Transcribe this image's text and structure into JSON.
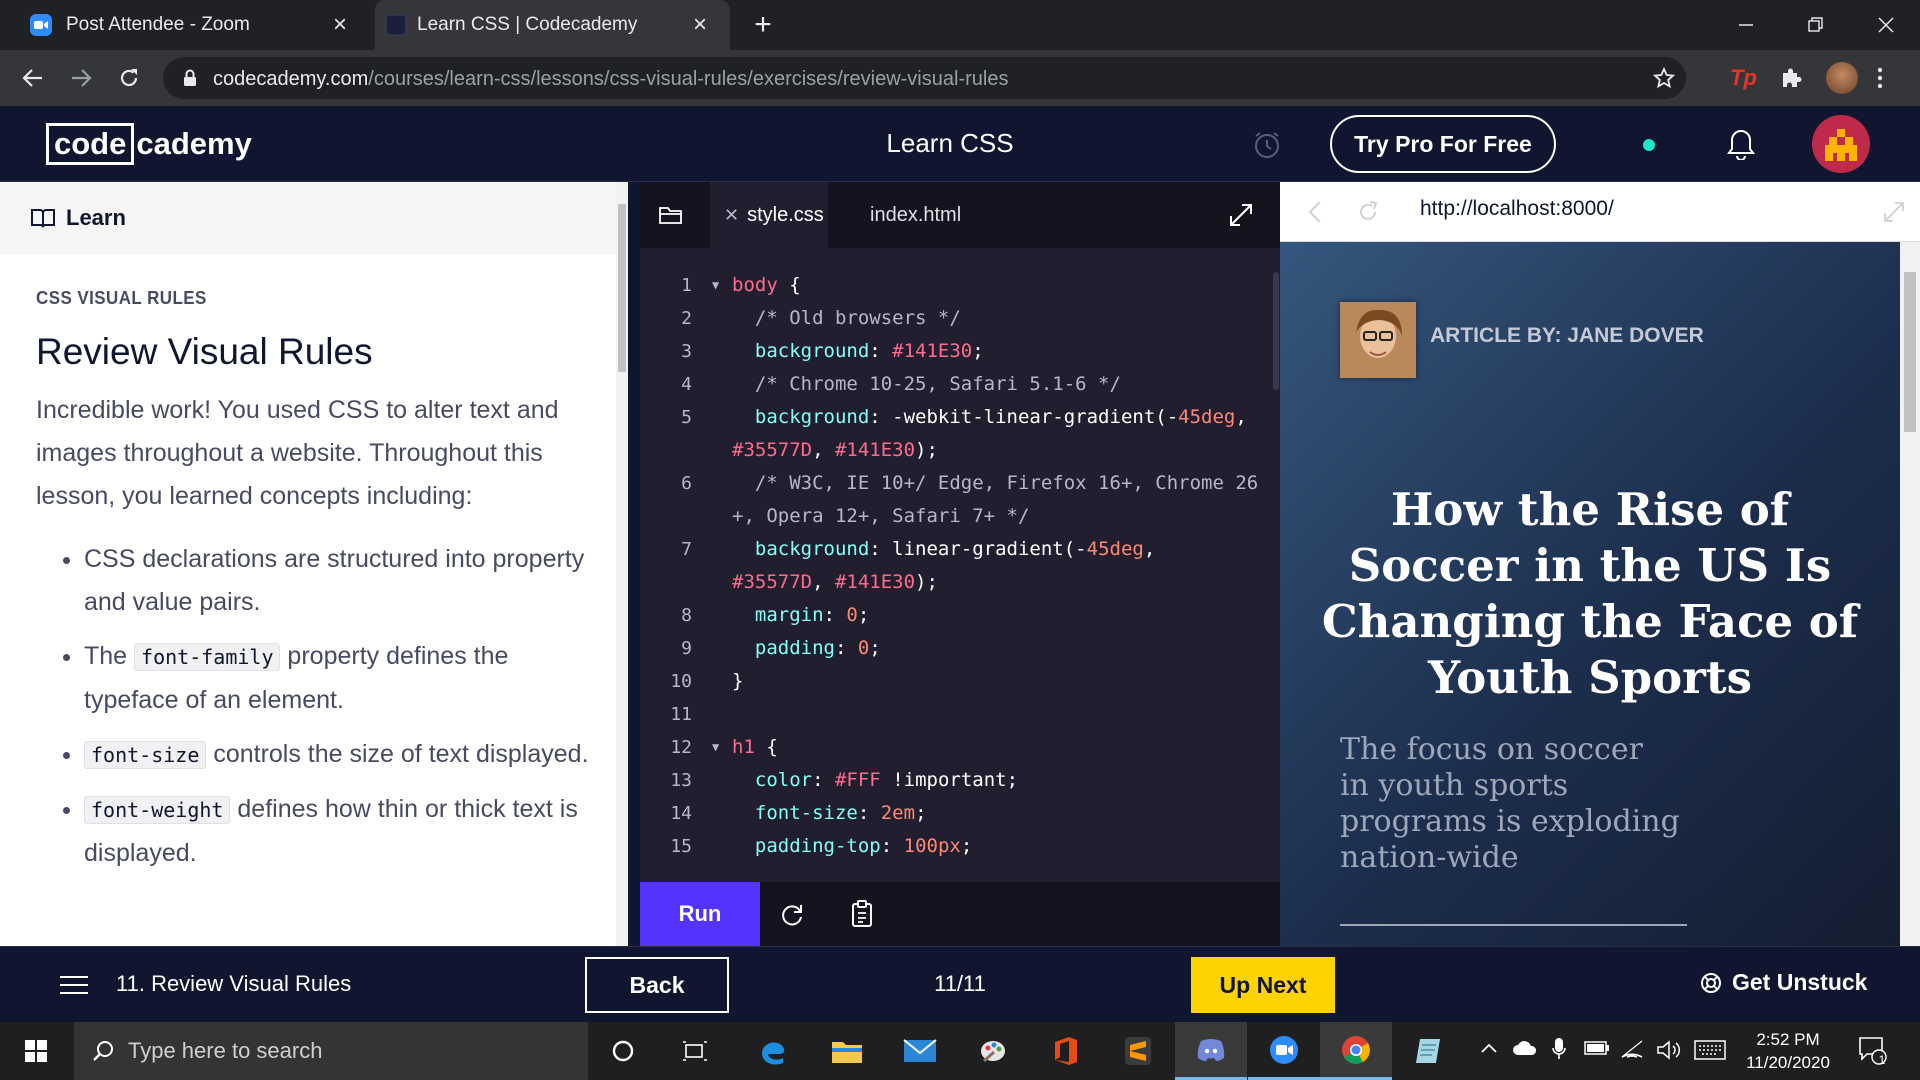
{
  "browser": {
    "tabs": [
      {
        "title": "Post Attendee - Zoom",
        "icon": "zoom-favicon"
      },
      {
        "title": "Learn CSS | Codecademy",
        "icon": "codecademy-favicon"
      }
    ],
    "url_host": "codecademy.com",
    "url_path": "/courses/learn-css/lessons/css-visual-rules/exercises/review-visual-rules",
    "extension_label": "Tp"
  },
  "header": {
    "logo_code": "code",
    "logo_rest": "cademy",
    "course_title": "Learn CSS",
    "try_pro_label": "Try Pro For Free"
  },
  "lesson": {
    "panel_tab": "Learn",
    "overline": "CSS VISUAL RULES",
    "title": "Review Visual Rules",
    "intro": "Incredible work! You used CSS to alter text and images throughout a website. Throughout this lesson, you learned concepts including:",
    "points": [
      {
        "code": "",
        "text": "CSS declarations are structured into property and value pairs."
      },
      {
        "before": "The ",
        "code": "font-family",
        "text": " property defines the typeface of an element."
      },
      {
        "code": "font-size",
        "text": " controls the size of text displayed."
      },
      {
        "code": "font-weight",
        "text": " defines how thin or thick text is displayed."
      }
    ]
  },
  "editor": {
    "tabs": [
      {
        "label": "style.css",
        "active": true
      },
      {
        "label": "index.html",
        "active": false
      }
    ],
    "run_label": "Run"
  },
  "preview": {
    "url": "http://localhost:8000/",
    "byline": "ARTICLE BY: JANE DOVER",
    "headline": "How the Rise of Soccer in the US Is Changing the Face of Youth Sports",
    "subtitle": "The focus on soccer in youth sports programs is exploding nation-wide"
  },
  "footer": {
    "lesson_name": "11. Review Visual Rules",
    "back_label": "Back",
    "progress": "11/11",
    "up_next_label": "Up Next",
    "get_unstuck_label": "Get Unstuck"
  },
  "taskbar": {
    "search_placeholder": "Type here to search",
    "time": "2:52 PM",
    "date": "11/20/2020",
    "notification_count": "1"
  },
  "colors": {
    "brand_dark": "#10162f",
    "run_button": "#5533ff",
    "up_next": "#ffd300",
    "code_bg": "#211e2f"
  }
}
